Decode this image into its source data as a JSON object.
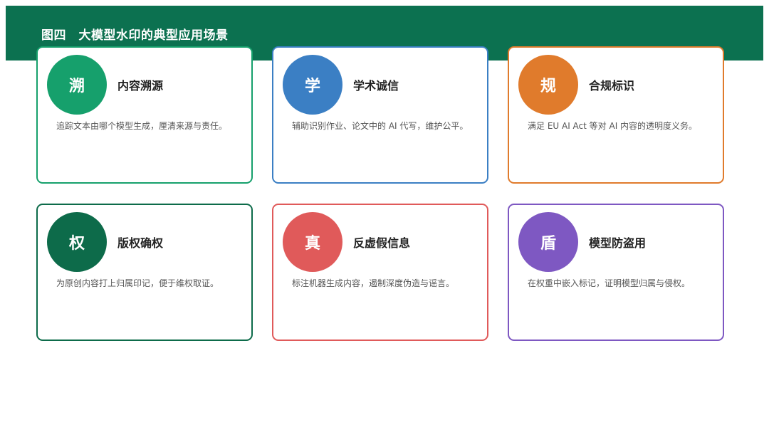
{
  "figure": {
    "title": "图四　大模型水印的典型应用场景"
  },
  "cards": [
    {
      "glyph": "溯",
      "title": "内容溯源",
      "description": "追踪文本由哪个模型生成，厘清来源与责任。",
      "color": "#16a06c"
    },
    {
      "glyph": "学",
      "title": "学术诚信",
      "description": "辅助识别作业、论文中的 AI 代写，维护公平。",
      "color": "#3b7fc4"
    },
    {
      "glyph": "规",
      "title": "合规标识",
      "description": "满足 EU AI Act 等对 AI 内容的透明度义务。",
      "color": "#e07b2c"
    },
    {
      "glyph": "权",
      "title": "版权确权",
      "description": "为原创内容打上归属印记，便于维权取证。",
      "color": "#0d6b4a"
    },
    {
      "glyph": "真",
      "title": "反虚假信息",
      "description": "标注机器生成内容，遏制深度伪造与谣言。",
      "color": "#e05a5a"
    },
    {
      "glyph": "盾",
      "title": "模型防盗用",
      "description": "在权重中嵌入标记，证明模型归属与侵权。",
      "color": "#7e58c2"
    }
  ]
}
